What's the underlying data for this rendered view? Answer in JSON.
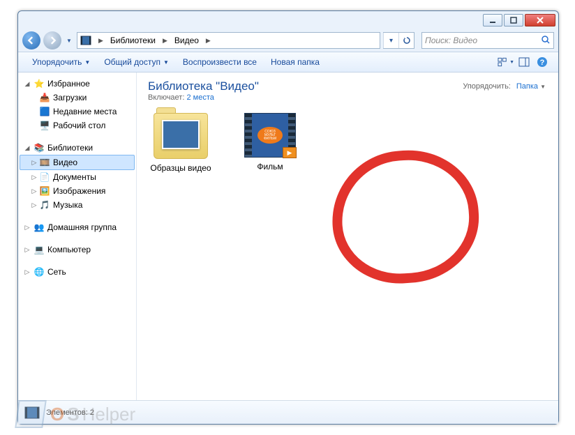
{
  "titlebar": {},
  "breadcrumb": {
    "items": [
      "Библиотеки",
      "Видео"
    ]
  },
  "search": {
    "placeholder": "Поиск: Видео"
  },
  "toolbar": {
    "organize": "Упорядочить",
    "shared": "Общий доступ",
    "play": "Воспроизвести все",
    "newfolder": "Новая папка"
  },
  "sidebar": {
    "favorites": "Избранное",
    "favorites_items": [
      "Загрузки",
      "Недавние места",
      "Рабочий стол"
    ],
    "libraries": "Библиотеки",
    "libraries_items": [
      "Видео",
      "Документы",
      "Изображения",
      "Музыка"
    ],
    "homegroup": "Домашняя группа",
    "computer": "Компьютер",
    "network": "Сеть"
  },
  "header": {
    "title": "Библиотека \"Видео\"",
    "includes_label": "Включает:",
    "includes_count": "2 места",
    "arrange_label": "Упорядочить:",
    "arrange_value": "Папка"
  },
  "items": [
    {
      "name": "Образцы видео",
      "type": "folder"
    },
    {
      "name": "Фильм",
      "type": "video"
    }
  ],
  "statusbar": {
    "count_label": "Элементов: 2"
  },
  "watermark": {
    "text_o": "O",
    "text_s": "S",
    "text_rest": "Helper"
  }
}
